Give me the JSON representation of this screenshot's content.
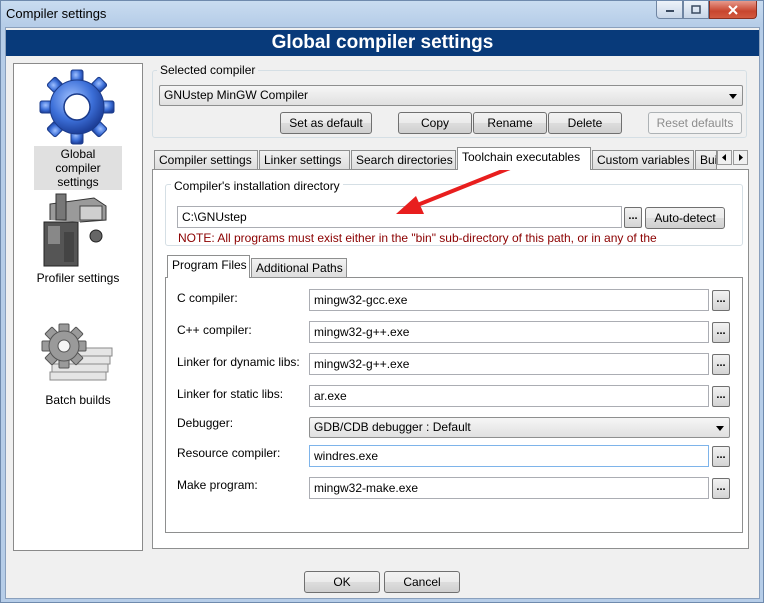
{
  "window": {
    "title": "Compiler settings",
    "header": "Global compiler settings"
  },
  "sidebar": {
    "items": [
      {
        "label": "Global compiler settings",
        "icon": "gear-icon",
        "selected": true
      },
      {
        "label": "Profiler settings",
        "icon": "stopwatch-icon",
        "selected": false
      },
      {
        "label": "Batch builds",
        "icon": "gear-stack-icon",
        "selected": false
      }
    ]
  },
  "selected_compiler": {
    "caption": "Selected compiler",
    "value": "GNUstep MinGW Compiler",
    "buttons": {
      "set_default": "Set as default",
      "copy": "Copy",
      "rename": "Rename",
      "delete": "Delete",
      "reset_defaults": "Reset defaults"
    }
  },
  "tabs": [
    {
      "label": "Compiler settings",
      "active": false
    },
    {
      "label": "Linker settings",
      "active": false
    },
    {
      "label": "Search directories",
      "active": false
    },
    {
      "label": "Toolchain executables",
      "active": true
    },
    {
      "label": "Custom variables",
      "active": false
    },
    {
      "label": "Bui",
      "active": false
    }
  ],
  "install_dir": {
    "caption": "Compiler's installation directory",
    "value": "C:\\GNUstep",
    "browse_label": "...",
    "auto_detect_label": "Auto-detect",
    "note": "NOTE: All programs must exist either in the \"bin\" sub-directory of this path, or in any of the"
  },
  "subtabs": [
    {
      "label": "Program Files",
      "active": true
    },
    {
      "label": "Additional Paths",
      "active": false
    }
  ],
  "programs": [
    {
      "label": "C compiler:",
      "value": "mingw32-gcc.exe",
      "type": "text"
    },
    {
      "label": "C++ compiler:",
      "value": "mingw32-g++.exe",
      "type": "text"
    },
    {
      "label": "Linker for dynamic libs:",
      "value": "mingw32-g++.exe",
      "type": "text"
    },
    {
      "label": "Linker for static libs:",
      "value": "ar.exe",
      "type": "text"
    },
    {
      "label": "Debugger:",
      "value": "GDB/CDB debugger : Default",
      "type": "combo"
    },
    {
      "label": "Resource compiler:",
      "value": "windres.exe",
      "type": "text"
    },
    {
      "label": "Make program:",
      "value": "mingw32-make.exe",
      "type": "text"
    }
  ],
  "dialog_buttons": {
    "ok": "OK",
    "cancel": "Cancel"
  },
  "colors": {
    "header_bg": "#083a7a",
    "note_text": "#8b0000",
    "annotation_arrow": "#e81e1e"
  }
}
